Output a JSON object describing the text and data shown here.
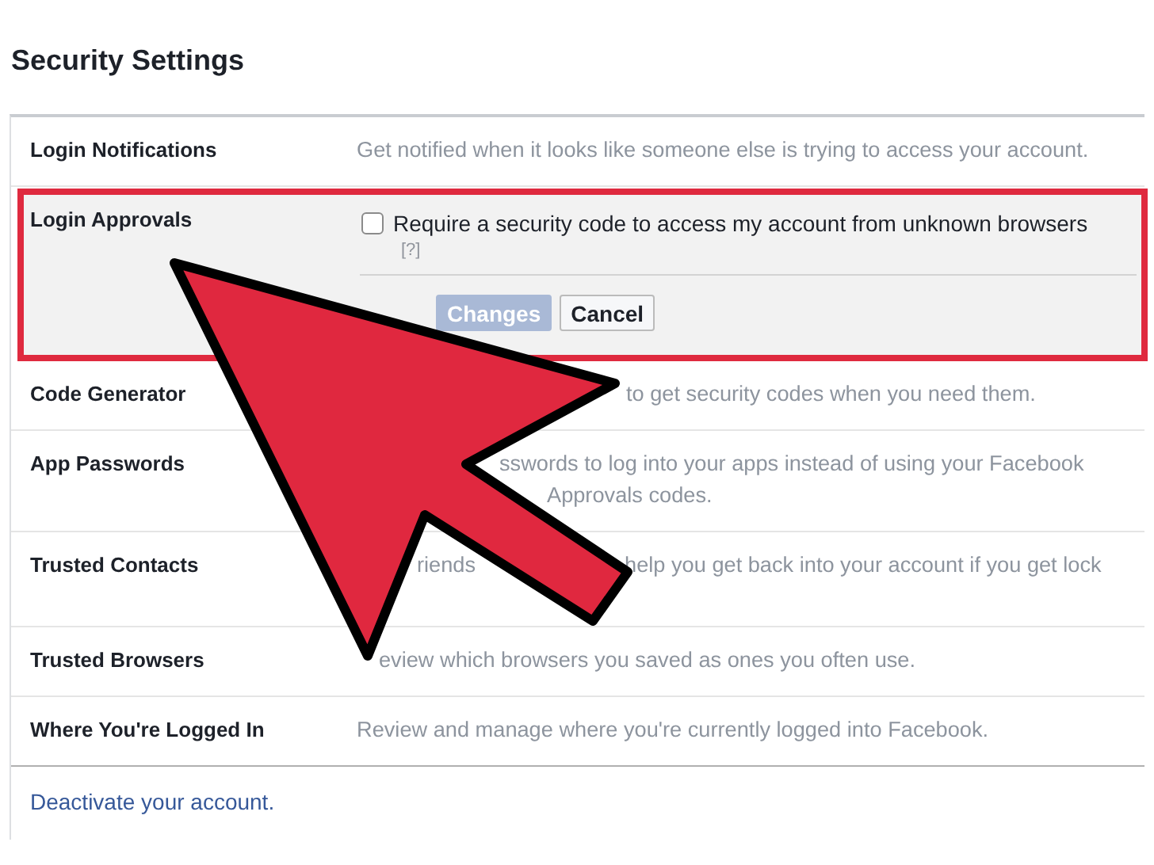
{
  "title": "Security Settings",
  "rows": [
    {
      "label": "Login Notifications",
      "kind": "text",
      "highlighted": false,
      "lines": [
        [
          "Get notified when it looks like someone else is trying to access your account."
        ]
      ]
    },
    {
      "label": "Login Approvals",
      "kind": "edit",
      "highlighted": true,
      "checkbox": {
        "label": "Require a security code to access my account from unknown browsers",
        "checked": false
      },
      "help": "[?]",
      "buttons": [
        {
          "label": "Changes",
          "kind": "primary"
        },
        {
          "label": "Cancel",
          "kind": "secondary"
        }
      ]
    },
    {
      "label": "Code Generator",
      "kind": "text",
      "highlighted": false,
      "lines": [
        [
          "to get security codes when you need them."
        ]
      ]
    },
    {
      "label": "App Passwords",
      "kind": "text",
      "highlighted": false,
      "lines": [
        [
          "sswords to log into your apps instead of using your Facebook"
        ],
        [
          "Approvals codes."
        ]
      ]
    },
    {
      "label": "Trusted Contacts",
      "kind": "text",
      "highlighted": false,
      "lines": [
        [
          "riends",
          "help you get back into your account if you get lock"
        ]
      ]
    },
    {
      "label": "Trusted Browsers",
      "kind": "text",
      "highlighted": false,
      "lines": [
        [
          "eview which browsers you saved as ones you often use."
        ]
      ]
    },
    {
      "label": "Where You're Logged In",
      "kind": "text",
      "highlighted": false,
      "lines": [
        [
          "Review and manage where you're currently logged into Facebook."
        ]
      ]
    }
  ],
  "footer_link": "Deactivate your account."
}
